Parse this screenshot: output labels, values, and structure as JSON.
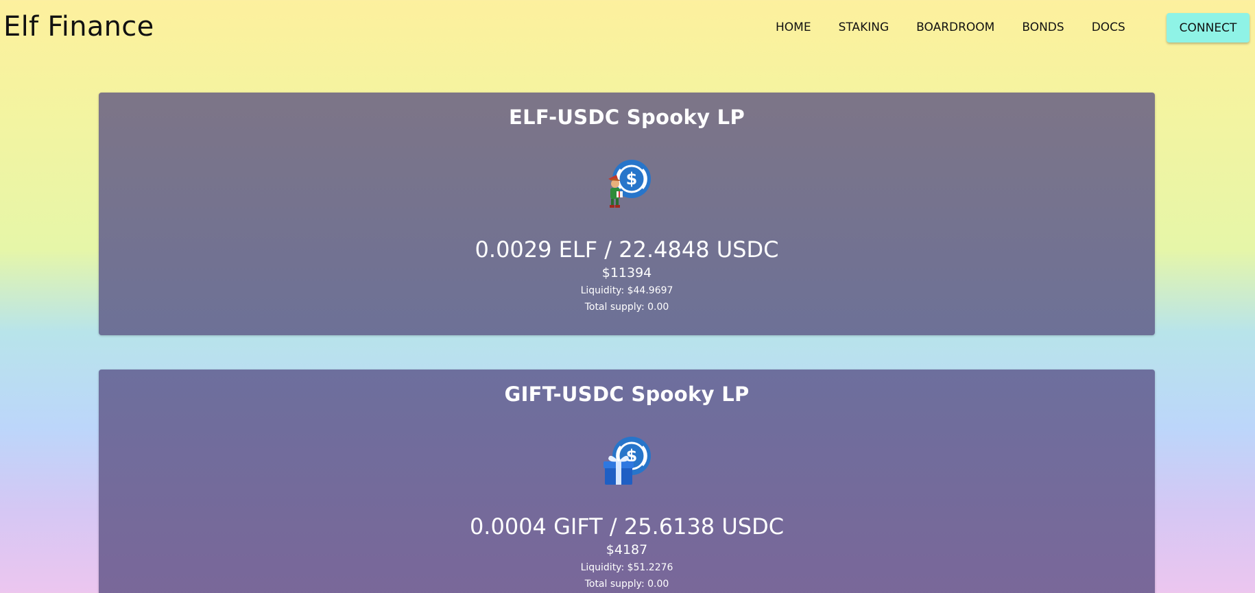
{
  "app": {
    "logo": "Elf Finance"
  },
  "nav": {
    "items": [
      "HOME",
      "STAKING",
      "BOARDROOM",
      "BONDS",
      "DOCS"
    ],
    "connect_label": "CONNECT"
  },
  "colors": {
    "connect_button": "#8ff3e6",
    "usdc_blue": "#2775ca"
  },
  "cards": [
    {
      "title": "ELF-USDC Spooky LP",
      "icons": [
        "elf-icon",
        "usdc-icon"
      ],
      "amounts": "0.0029 ELF / 22.4848 USDC",
      "price": "$11394",
      "liquidity": "Liquidity: $44.9697",
      "supply": "Total supply: 0.00"
    },
    {
      "title": "GIFT-USDC Spooky LP",
      "icons": [
        "gift-icon",
        "usdc-icon"
      ],
      "amounts": "0.0004 GIFT / 25.6138 USDC",
      "price": "$4187",
      "liquidity": "Liquidity: $51.2276",
      "supply": "Total supply: 0.00"
    }
  ]
}
